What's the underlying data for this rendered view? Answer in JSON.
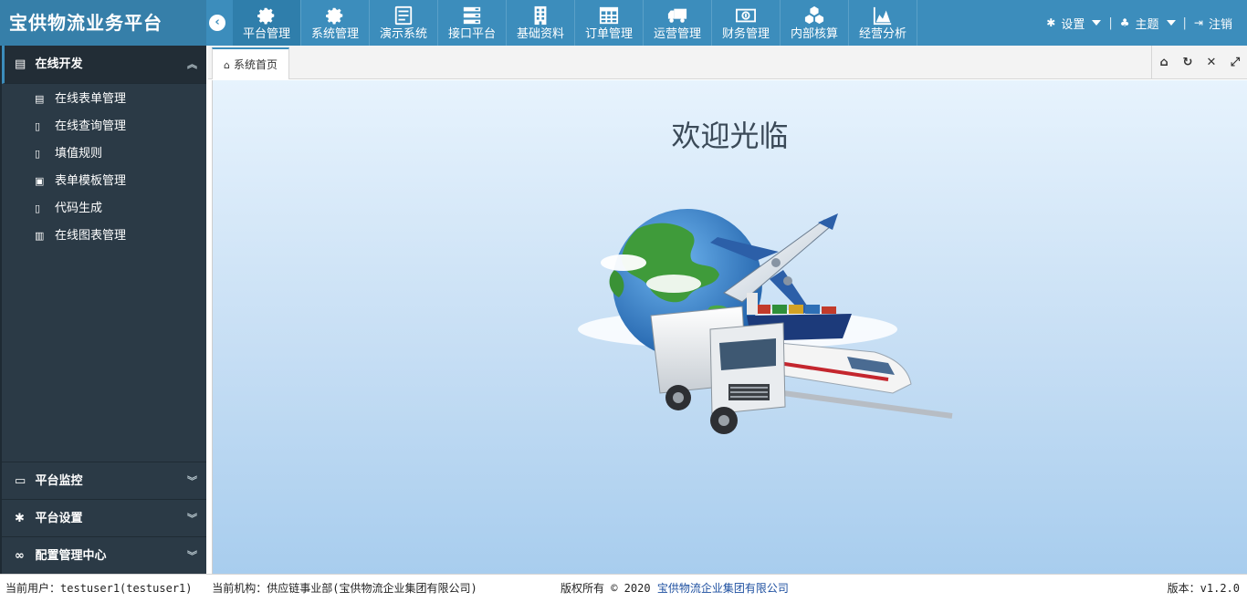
{
  "app": {
    "title": "宝供物流业务平台"
  },
  "topnav": [
    {
      "label": "平台管理",
      "icon": "gear-icon",
      "active": true
    },
    {
      "label": "系统管理",
      "icon": "gear-icon"
    },
    {
      "label": "演示系统",
      "icon": "form-icon"
    },
    {
      "label": "接口平台",
      "icon": "server-icon"
    },
    {
      "label": "基础资料",
      "icon": "building-icon"
    },
    {
      "label": "订单管理",
      "icon": "table-icon"
    },
    {
      "label": "运营管理",
      "icon": "truck-icon"
    },
    {
      "label": "财务管理",
      "icon": "money-icon"
    },
    {
      "label": "内部核算",
      "icon": "cubes-icon"
    },
    {
      "label": "经营分析",
      "icon": "area-chart-icon"
    }
  ],
  "header_right": {
    "settings": "设置",
    "theme": "主题",
    "logout": "注销"
  },
  "sidebar": {
    "open_group": "在线开发",
    "items": [
      {
        "label": "在线表单管理",
        "icon": "form-icon"
      },
      {
        "label": "在线查询管理",
        "icon": "file-icon"
      },
      {
        "label": "填值规则",
        "icon": "file-icon"
      },
      {
        "label": "表单模板管理",
        "icon": "id-card-icon"
      },
      {
        "label": "代码生成",
        "icon": "file-icon"
      },
      {
        "label": "在线图表管理",
        "icon": "bar-chart-icon"
      }
    ],
    "bottom_groups": [
      {
        "label": "平台监控",
        "icon": "monitor-icon"
      },
      {
        "label": "平台设置",
        "icon": "gear-icon"
      },
      {
        "label": "配置管理中心",
        "icon": "handshake-icon"
      }
    ]
  },
  "tabs": {
    "home": "系统首页"
  },
  "welcome": {
    "title": "欢迎光临"
  },
  "footer": {
    "user_label": "当前用户：",
    "user_value": "testuser1(testuser1)",
    "org_label": "当前机构：",
    "org_value": "供应链事业部(宝供物流企业集团有限公司)",
    "copyright": "版权所有 © 2020",
    "company": "宝供物流企业集团有限公司",
    "version": "版本：v1.2.0"
  },
  "colors": {
    "header": "#3c8dbc",
    "sidebar": "#2b3a46",
    "accent": "#3c8dbc"
  }
}
